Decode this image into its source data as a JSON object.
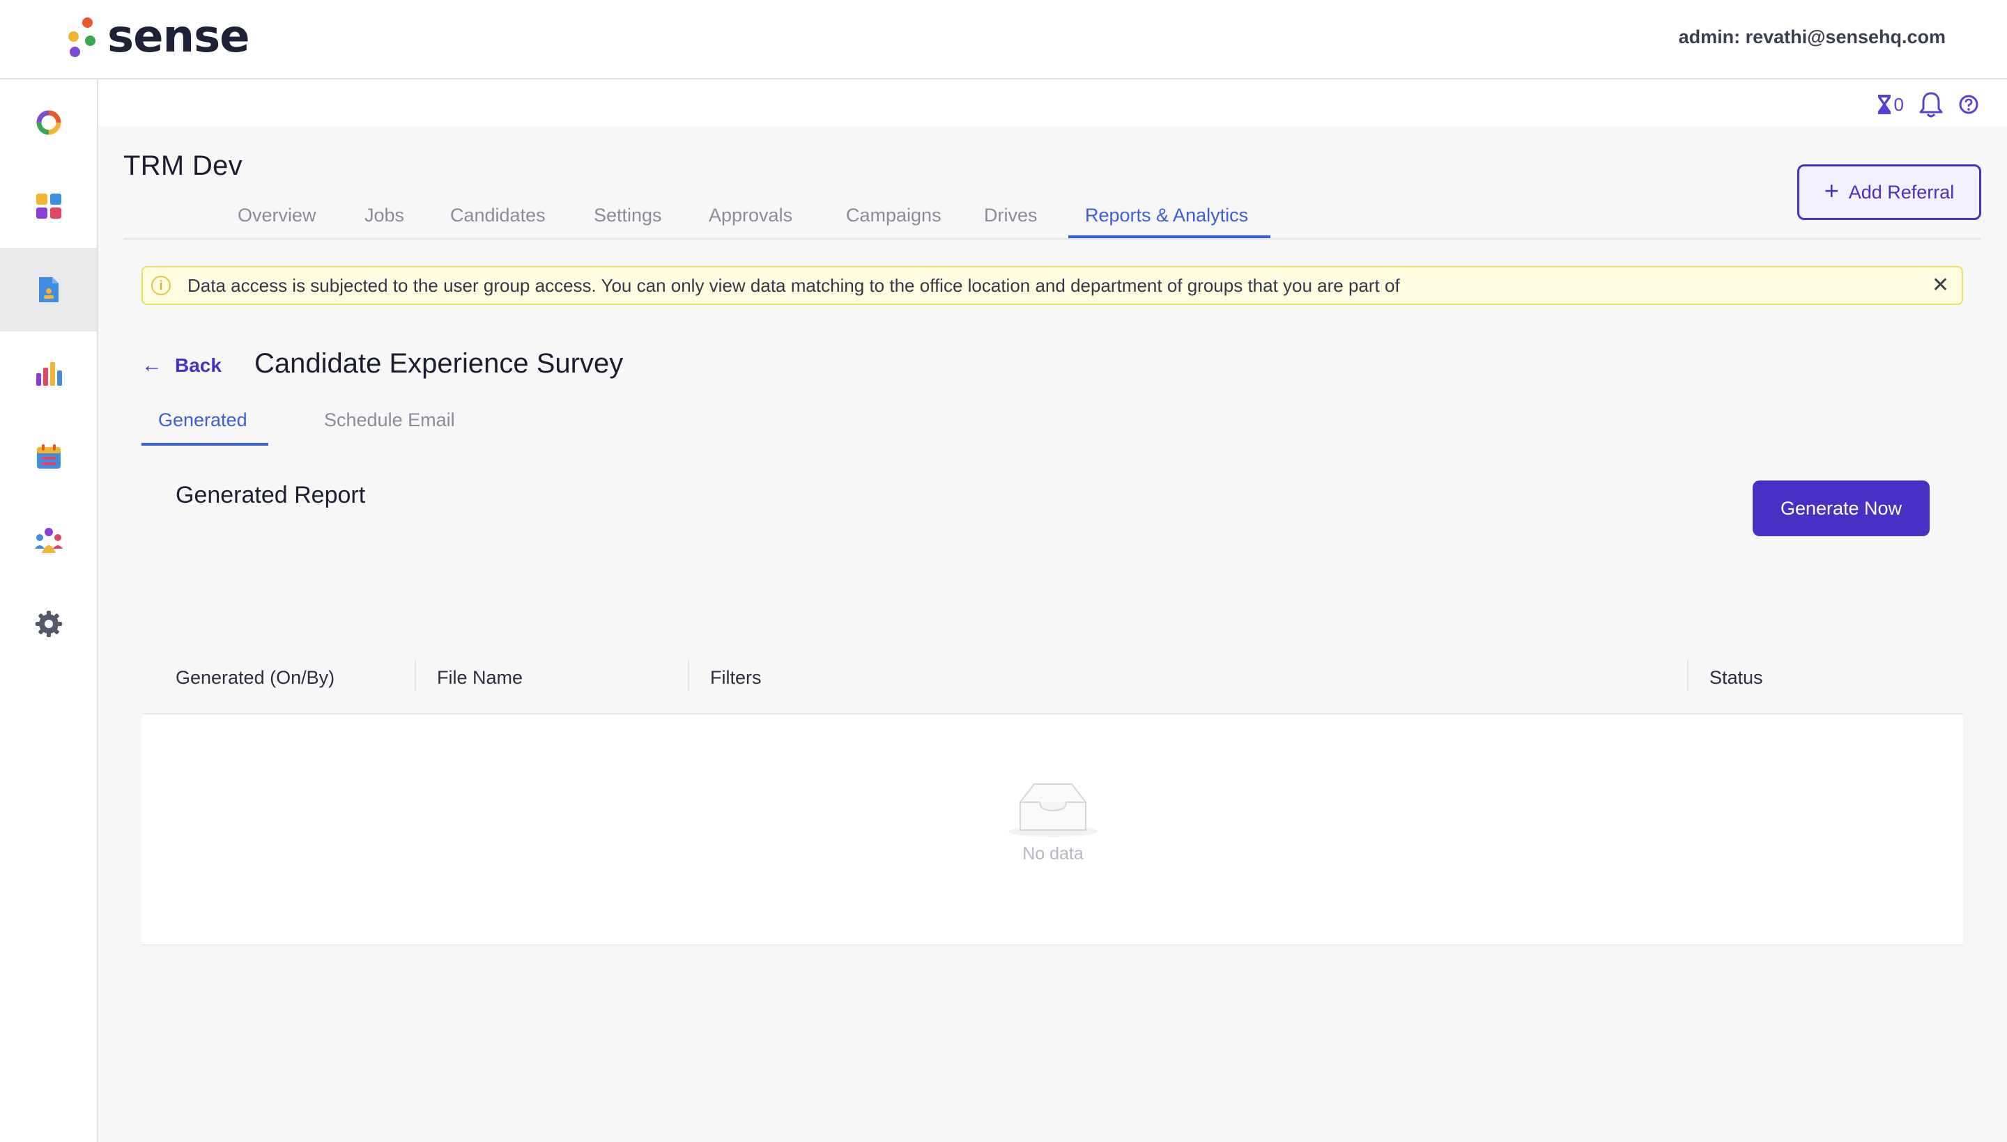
{
  "header": {
    "logo_text": "sense",
    "admin_label": "admin: revathi@sensehq.com"
  },
  "sidebar": {
    "items": [
      {
        "icon": "sense-ring-icon"
      },
      {
        "icon": "dashboard-grid-icon"
      },
      {
        "icon": "document-icon",
        "active": true
      },
      {
        "icon": "bar-chart-icon"
      },
      {
        "icon": "calendar-icon"
      },
      {
        "icon": "people-icon"
      },
      {
        "icon": "gear-icon"
      }
    ]
  },
  "utility": {
    "pending_count": "0"
  },
  "page": {
    "title": "TRM Dev",
    "add_referral_label": "Add Referral"
  },
  "tabs": [
    {
      "label": "Overview"
    },
    {
      "label": "Jobs"
    },
    {
      "label": "Candidates"
    },
    {
      "label": "Settings"
    },
    {
      "label": "Approvals"
    },
    {
      "label": "Campaigns"
    },
    {
      "label": "Drives"
    },
    {
      "label": "Reports & Analytics",
      "active": true
    }
  ],
  "banner": {
    "text": "Data access is subjected to the user group access. You can only view data matching to the office location and department of groups that you are part of"
  },
  "report": {
    "back_label": "Back",
    "title": "Candidate Experience Survey",
    "subtabs": [
      {
        "label": "Generated",
        "active": true
      },
      {
        "label": "Schedule Email"
      }
    ],
    "section_title": "Generated Report",
    "generate_label": "Generate Now"
  },
  "table": {
    "columns": [
      "Generated (On/By)",
      "File Name",
      "Filters",
      "Status"
    ],
    "empty_text": "No data"
  },
  "colors": {
    "accent": "#4a2fc4",
    "tab_active": "#3a5fd6",
    "banner_bg": "#fefbe0"
  }
}
